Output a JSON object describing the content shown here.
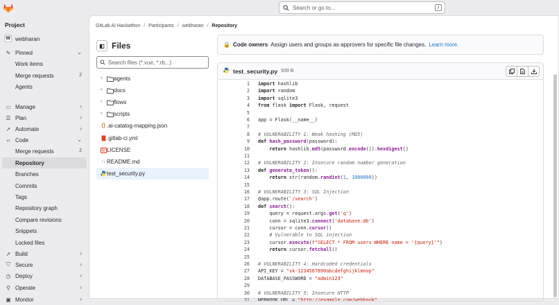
{
  "topbar": {
    "search_placeholder": "Search or go to...",
    "search_shortcut": "/"
  },
  "sidebar": {
    "header": "Project",
    "project_name": "webharan",
    "project_initial": "W",
    "items": [
      {
        "label": "Pinned",
        "icon": "pin-icon",
        "chevron": "⌄"
      },
      {
        "label": "Work items"
      },
      {
        "label": "Merge requests",
        "count": "2"
      },
      {
        "label": "Agents"
      },
      {
        "label": "Manage",
        "icon": "briefcase-icon",
        "chevron": "›"
      },
      {
        "label": "Plan",
        "icon": "plan-icon",
        "chevron": "›"
      },
      {
        "label": "Automate",
        "icon": "rocket-icon",
        "chevron": "›"
      },
      {
        "label": "Code",
        "icon": "code-icon",
        "chevron": "⌄"
      },
      {
        "label": "Merge requests",
        "count": "2"
      },
      {
        "label": "Repository"
      },
      {
        "label": "Branches"
      },
      {
        "label": "Commits"
      },
      {
        "label": "Tags"
      },
      {
        "label": "Repository graph"
      },
      {
        "label": "Compare revisions"
      },
      {
        "label": "Snippets"
      },
      {
        "label": "Locked files"
      },
      {
        "label": "Build",
        "icon": "rocket-icon",
        "chevron": "›"
      },
      {
        "label": "Secure",
        "icon": "shield-icon",
        "chevron": "›"
      },
      {
        "label": "Deploy",
        "icon": "deploy-icon",
        "chevron": "›"
      },
      {
        "label": "Operate",
        "icon": "operate-icon",
        "chevron": "›"
      },
      {
        "label": "Monitor",
        "icon": "monitor-icon",
        "chevron": "›"
      }
    ]
  },
  "breadcrumb": [
    "GitLab AI Hackathon",
    "Participants",
    "webharan",
    "Repository"
  ],
  "files_panel": {
    "title": "Files",
    "filter_placeholder": "Search files (*.vue, *.rb...)",
    "folders": [
      "agents",
      "docs",
      "flows",
      "scripts"
    ],
    "files": [
      ".ai-catalog-mapping.json",
      ".gitlab-ci.yml",
      "LICENSE",
      "README.md",
      "test_security.py"
    ],
    "selected": "test_security.py"
  },
  "code_owners": {
    "label": "Code owners",
    "text": "Assign users and groups as approvers for specific file changes.",
    "link": "Learn more."
  },
  "file_view": {
    "filename": "test_security.py",
    "size": "939 B",
    "lines": [
      "import hashlib",
      "import random",
      "import sqlite3",
      "from flask import Flask, request",
      "",
      "app = Flask(__name__)",
      "",
      "# VULNERABILITY 1: Weak hashing (MD5)",
      "def hash_password(password):",
      "    return hashlib.md5(password.encode()).hexdigest()",
      "",
      "# VULNERABILITY 2: Insecure random number generation",
      "def generate_token():",
      "    return str(random.randint(1, 1000000))",
      "",
      "# VULNERABILITY 3: SQL Injection",
      "@app.route('/search')",
      "def search():",
      "    query = request.args.get('q')",
      "    conn = sqlite3.connect('database.db')",
      "    cursor = conn.cursor()",
      "    # Vulnerable to SQL injection",
      "    cursor.execute(f\"SELECT * FROM users WHERE name = '{query}'\")",
      "    return cursor.fetchall()",
      "",
      "# VULNERABILITY 4: Hardcoded credentials",
      "API_KEY = \"sk-1234567890abcdefghijklmnop\"",
      "DATABASE_PASSWORD = \"admin123\"",
      "",
      "# VULNERABILITY 5: Insecure HTTP",
      "WEBHOOK_URL = \"http://example.com/webhook\""
    ]
  },
  "colors": {
    "brand": "#e24329",
    "link": "#1f75cb",
    "selected_bg": "#e9f3fc"
  }
}
